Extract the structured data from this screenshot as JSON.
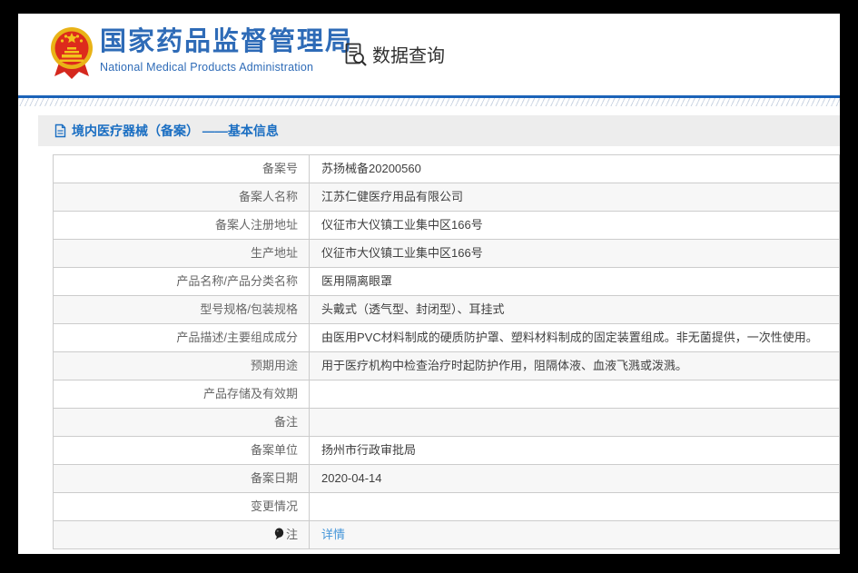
{
  "header": {
    "org_name": "国家药品监督管理局",
    "org_name_en": "National Medical Products Administration",
    "nav_label": "数据查询"
  },
  "section": {
    "title": "境内医疗器械（备案） ——基本信息"
  },
  "table": {
    "rows": [
      {
        "label": "备案号",
        "value": "苏扬械备20200560"
      },
      {
        "label": "备案人名称",
        "value": "江苏仁健医疗用品有限公司"
      },
      {
        "label": "备案人注册地址",
        "value": "仪征市大仪镇工业集中区166号"
      },
      {
        "label": "生产地址",
        "value": "仪征市大仪镇工业集中区166号"
      },
      {
        "label": "产品名称/产品分类名称",
        "value": "医用隔离眼罩"
      },
      {
        "label": "型号规格/包装规格",
        "value": "头戴式（透气型、封闭型）、耳挂式"
      },
      {
        "label": "产品描述/主要组成成分",
        "value": "由医用PVC材料制成的硬质防护罩、塑料材料制成的固定装置组成。非无菌提供，一次性使用。"
      },
      {
        "label": "预期用途",
        "value": "用于医疗机构中检查治疗时起防护作用，阻隔体液、血液飞溅或泼溅。"
      },
      {
        "label": "产品存储及有效期",
        "value": ""
      },
      {
        "label": "备注",
        "value": ""
      },
      {
        "label": "备案单位",
        "value": "扬州市行政审批局"
      },
      {
        "label": "备案日期",
        "value": "2020-04-14"
      },
      {
        "label": "变更情况",
        "value": ""
      },
      {
        "label": "注",
        "value": "详情"
      }
    ]
  },
  "colors": {
    "brand_blue": "#2e6bb7",
    "rule_blue": "#1b63b8",
    "section_blue": "#1a6ec2",
    "link_blue": "#4596d9",
    "alt_row": "#f7f7f7"
  }
}
